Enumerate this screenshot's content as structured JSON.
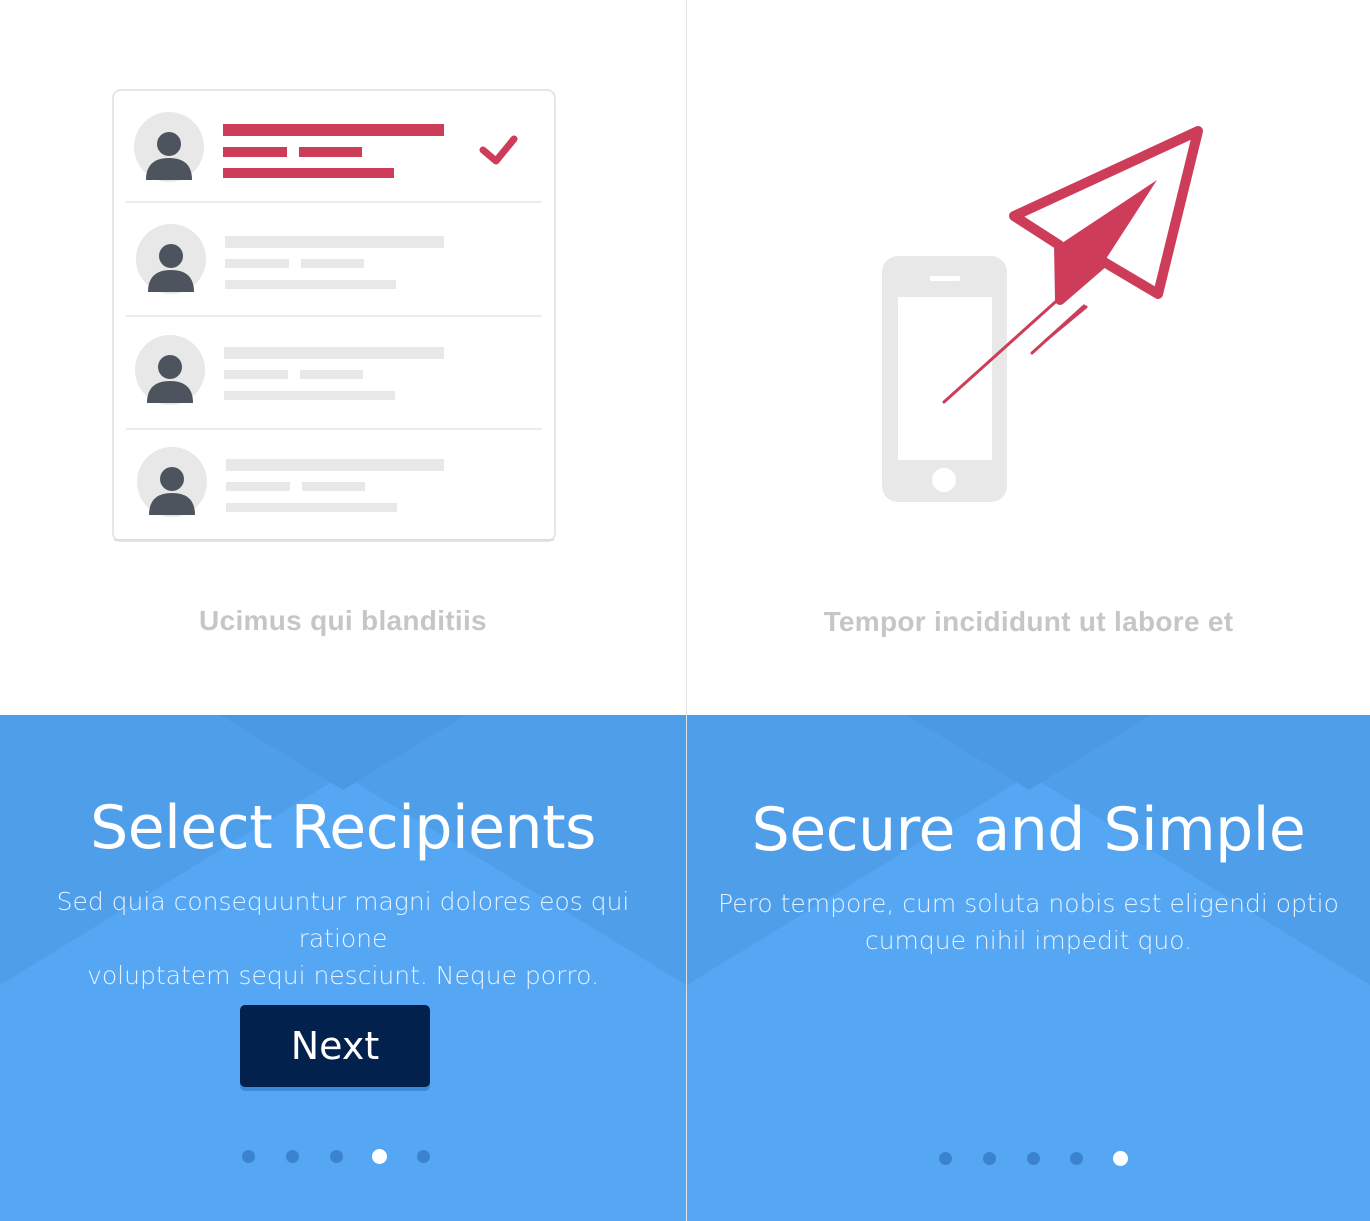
{
  "screens": [
    {
      "caption": "Ucimus qui blanditiis",
      "title": "Select Recipients",
      "body_line1": "Sed quia consequuntur magni dolores eos qui ratione",
      "body_line2": "voluptatem sequi nesciunt. Neque porro.",
      "button_label": "Next",
      "pager": {
        "count": 5,
        "active_index": 3
      }
    },
    {
      "caption": "Tempor incididunt ut labore et",
      "title": "Secure and Simple",
      "body_line1": "Pero tempore, cum soluta nobis est eligendi optio",
      "body_line2": "cumque nihil impedit quo.",
      "pager": {
        "count": 5,
        "active_index": 4
      }
    }
  ],
  "colors": {
    "accent_red": "#cd3d5a",
    "panel_blue": "#55a7f3",
    "button_navy": "#03214d",
    "placeholder_gray": "#e8e8e8",
    "avatar_dark": "#4d545e"
  },
  "icons": [
    "user-avatar-icon",
    "checkmark-icon",
    "smartphone-icon",
    "paper-plane-icon"
  ]
}
